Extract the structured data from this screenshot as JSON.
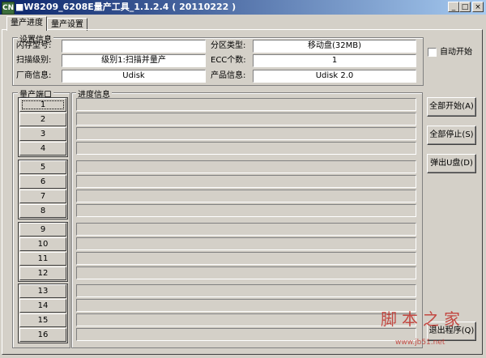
{
  "window": {
    "title": "■W8209_6208E量产工具_1.1.2.4 ( 20110222 )",
    "icon_label": "CN",
    "minimize": "_",
    "maximize": "□",
    "close": "×"
  },
  "tabs": [
    {
      "label": "量产进度",
      "active": true
    },
    {
      "label": "量产设置",
      "active": false
    }
  ],
  "settings": {
    "group_label": "设置信息",
    "flash_type_label": "闪存型号:",
    "flash_type_value": "",
    "partition_label": "分区类型:",
    "partition_value": "移动盘(32MB)",
    "scan_level_label": "扫描级别:",
    "scan_level_value": "级别1:扫描并量产",
    "ecc_label": "ECC个数:",
    "ecc_value": "1",
    "vendor_label": "厂商信息:",
    "vendor_value": "Udisk",
    "product_label": "产品信息:",
    "product_value": "Udisk 2.0"
  },
  "auto_start_label": "自动开始",
  "ports_group_label": "量产端口",
  "progress_group_label": "进度信息",
  "ports": [
    "1",
    "2",
    "3",
    "4",
    "5",
    "6",
    "7",
    "8",
    "9",
    "10",
    "11",
    "12",
    "13",
    "14",
    "15",
    "16"
  ],
  "buttons": {
    "start_all": "全部开始(A)",
    "stop_all": "全部停止(S)",
    "eject": "弹出U盘(D)",
    "exit": "退出程序(Q)"
  },
  "watermark": {
    "text": "脚本之家",
    "url": "www.jb51.net"
  },
  "colors": {
    "title_start": "#0a246a",
    "title_end": "#a6caf0",
    "face": "#d4d0c8",
    "watermark": "#c0302a"
  }
}
